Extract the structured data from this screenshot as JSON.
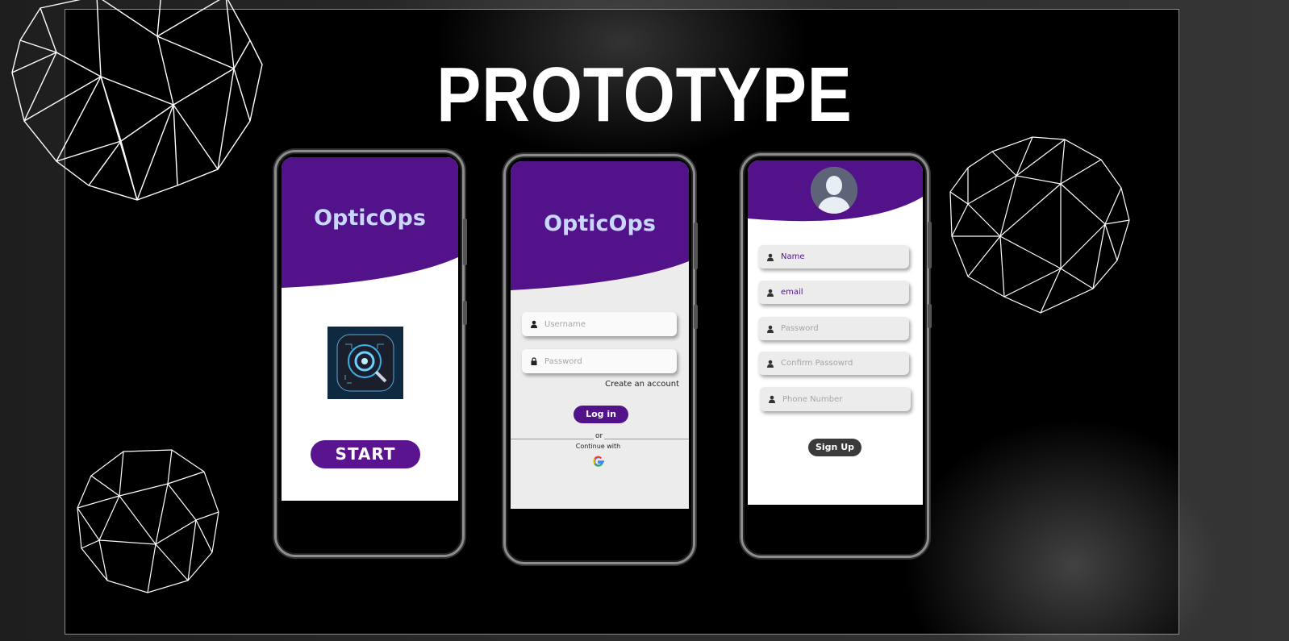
{
  "title": "PROTOTYPE",
  "colors": {
    "brand_purple": "#521289",
    "brand_text": "#c9d7ff",
    "background": "#000000"
  },
  "screen1": {
    "brand": "OpticOps",
    "start_label": "START",
    "app_icon": "eye-scanner-app-icon"
  },
  "screen2": {
    "brand": "OpticOps",
    "username_placeholder": "Username",
    "password_placeholder": "Password",
    "create_account": "Create an account",
    "login_label": "Log in",
    "or_text": "or",
    "continue_with": "Continue with",
    "google_icon": "google-icon"
  },
  "screen3": {
    "avatar_icon": "user-avatar-icon",
    "name_placeholder": "Name",
    "email_placeholder": "email",
    "password_placeholder": "Password",
    "confirm_placeholder": "Confirm Passowrd",
    "phone_placeholder": "Phone Number",
    "signup_label": "Sign Up"
  }
}
